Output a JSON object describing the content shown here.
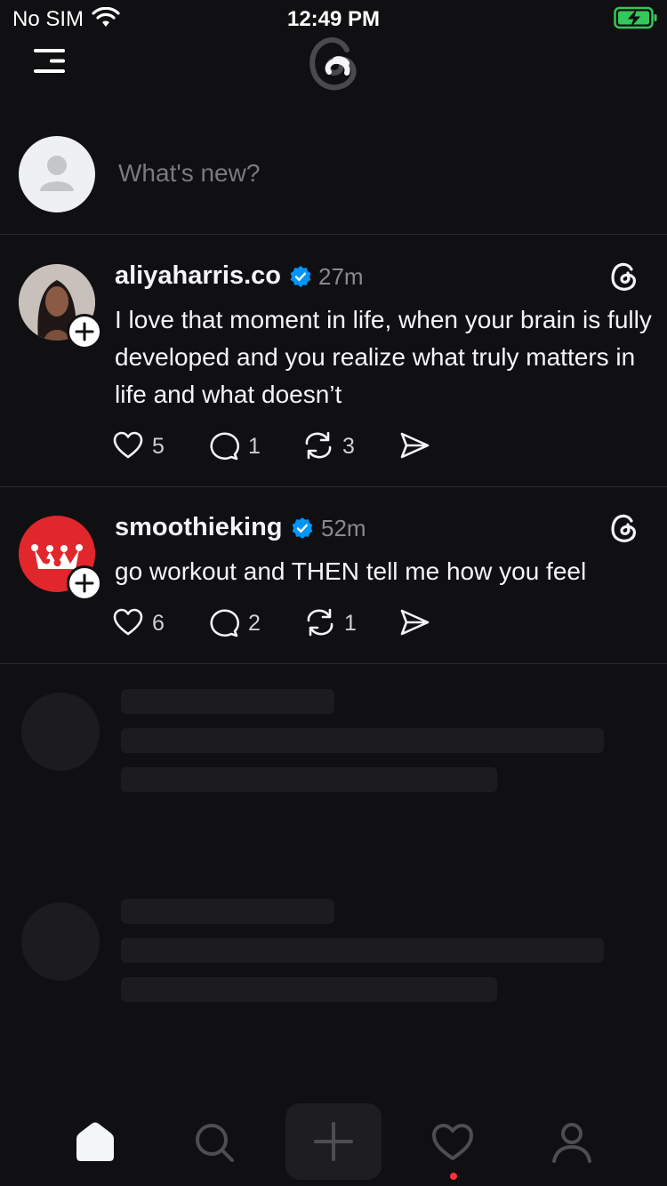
{
  "status_bar": {
    "carrier": "No SIM",
    "time": "12:49 PM"
  },
  "composer": {
    "placeholder": "What's new?"
  },
  "posts": [
    {
      "username": "aliyaharris.co",
      "time": "27m",
      "text": "I love that moment in life, when your brain is fully developed and you realize what truly matters in life and what doesn’t",
      "likes": "5",
      "replies": "1",
      "reposts": "3"
    },
    {
      "username": "smoothieking",
      "time": "52m",
      "text": "go workout and THEN tell me how you feel",
      "likes": "6",
      "replies": "2",
      "reposts": "1"
    }
  ],
  "colors": {
    "background": "#101012",
    "verified": "#0095f6",
    "notification": "#ff3040",
    "battery": "#34c759"
  },
  "icons": [
    "wifi-icon",
    "battery-icon",
    "menu-icon",
    "threads-logo",
    "verified-icon",
    "threads-icon",
    "heart-icon",
    "reply-icon",
    "repost-icon",
    "share-icon",
    "home-icon",
    "search-icon",
    "plus-icon",
    "activity-icon",
    "profile-icon"
  ]
}
